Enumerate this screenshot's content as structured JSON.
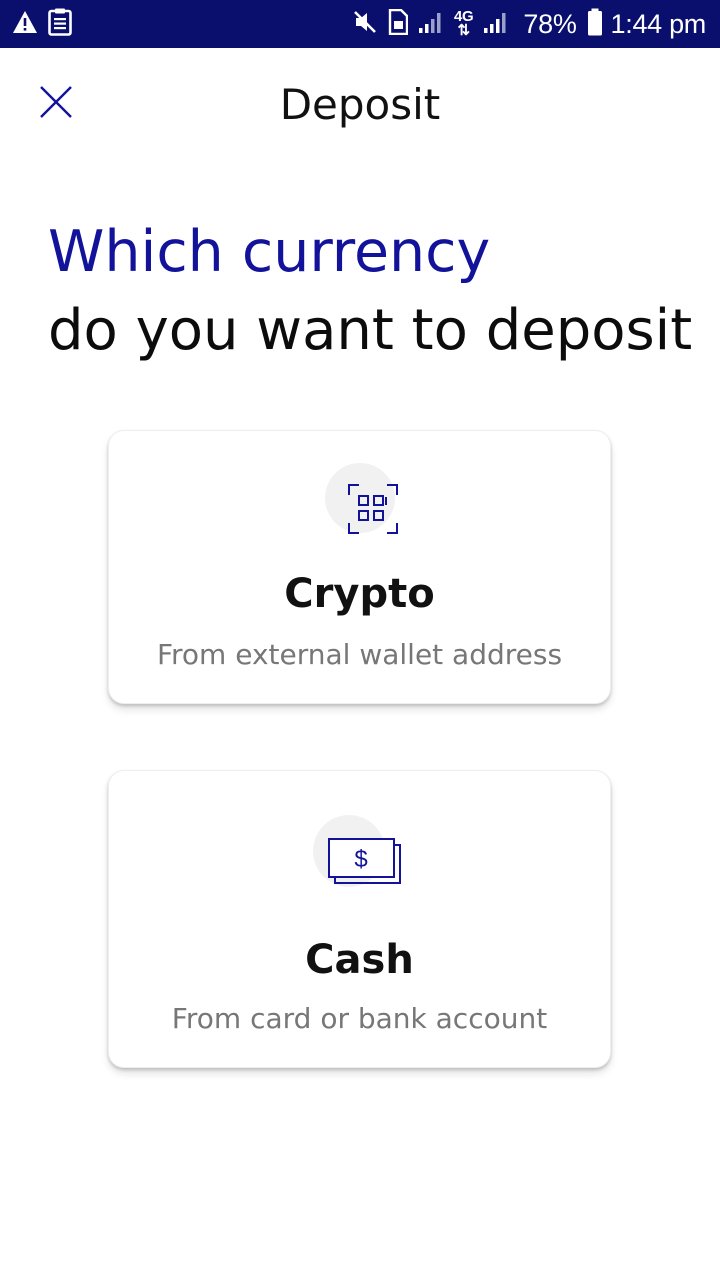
{
  "status_bar": {
    "battery_percent": "78%",
    "time": "1:44 pm",
    "network": "4G",
    "icons": [
      "warning-icon",
      "clipboard-icon",
      "mute-icon",
      "sim-icon",
      "signal-icon",
      "signal-icon",
      "battery-icon"
    ]
  },
  "header": {
    "title": "Deposit",
    "close_icon": "close-icon"
  },
  "headline": {
    "line1": "Which currency",
    "line2": "do you want to deposit"
  },
  "options": [
    {
      "title": "Crypto",
      "subtitle": "From external wallet address",
      "icon": "qr-code-icon"
    },
    {
      "title": "Cash",
      "subtitle": "From card or bank account",
      "icon": "cash-icon"
    }
  ],
  "colors": {
    "status_bar": "#0a0f6e",
    "accent": "#12139a",
    "text": "#0c0c0c",
    "subtext": "#777777"
  }
}
